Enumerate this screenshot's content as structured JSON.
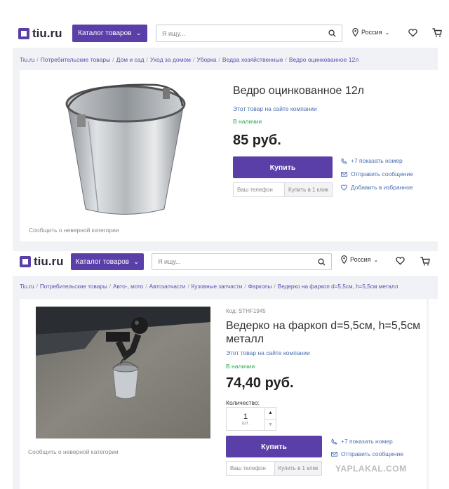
{
  "screen1": {
    "logo": "tiu.ru",
    "catalog_label": "Каталог товаров",
    "search_placeholder": "Я ищу...",
    "region": "Россия",
    "breadcrumbs": [
      "Tiu.ru",
      "Потребительские товары",
      "Дом и сад",
      "Уход за домом",
      "Уборка",
      "Ведра хозяйственные",
      "Ведро оцинкованное 12л"
    ],
    "product_title": "Ведро оцинкованное 12л",
    "company_link": "Этот товар на сайте компании",
    "stock": "В наличии",
    "price": "85 руб.",
    "buy_label": "Купить",
    "phone_placeholder": "Ваш телефон",
    "oneclick_label": "Купить в 1 клик",
    "actions": [
      "+7 показать номер",
      "Отправить сообщение",
      "Добавить в избранное"
    ],
    "report_link": "Сообщить о неверной категории"
  },
  "screen2": {
    "logo": "tiu.ru",
    "catalog_label": "Каталог товаров",
    "search_placeholder": "Я ищу...",
    "region": "Россия",
    "breadcrumbs": [
      "Tiu.ru",
      "Потребительские товары",
      "Авто-, мото",
      "Автозапчасти",
      "Кузовные запчасти",
      "Фаркопы",
      "Ведерко на фаркоп d=5,5см, h=5,5см металл"
    ],
    "code": "Код: STHF1945",
    "product_title_line1": "Ведерко на фаркоп d=5,5см, h=5,5см",
    "product_title_line2": "металл",
    "company_link": "Этот товар на сайте компании",
    "stock": "В наличии",
    "price": "74,40 руб.",
    "quantity_label": "Количество:",
    "quantity_value": "1",
    "quantity_unit": "шт.",
    "buy_label": "Купить",
    "phone_placeholder": "Ваш телефон",
    "oneclick_label": "Купить в 1 клик",
    "actions": [
      "+7 показать номер",
      "Отправить сообщение"
    ],
    "report_link": "Сообщить о неверной категории"
  },
  "watermark": "YAPLAKAL.COM",
  "colors": {
    "brand": "#5a3fa8",
    "link": "#4a6fb0",
    "stock": "#2ea84c"
  }
}
